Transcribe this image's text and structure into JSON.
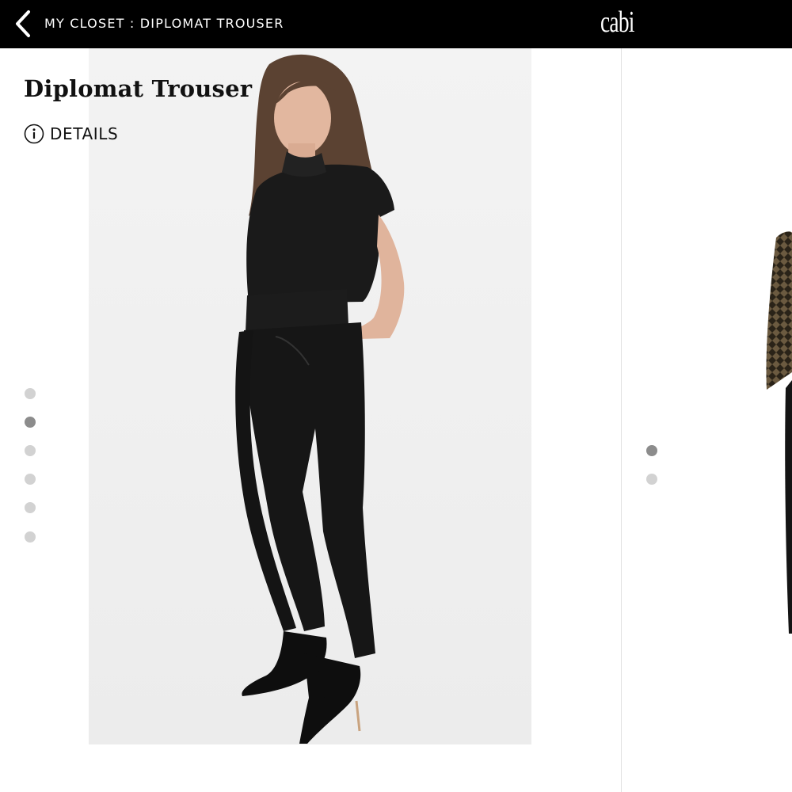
{
  "header": {
    "breadcrumb": "MY CLOSET : DIPLOMAT TROUSER",
    "logo_text": "cabi"
  },
  "product": {
    "title": "Diplomat Trouser",
    "details_label": "DETAILS",
    "image_alt": "Model wearing black Diplomat Trouser with black short-sleeve top and black heels"
  },
  "carousel": {
    "dot_count": 6,
    "active_index": 1
  },
  "next_item": {
    "dot_count": 2,
    "active_index": 0
  },
  "colors": {
    "header_bg": "#000000",
    "dot_inactive": "#d2d2d2",
    "dot_active": "#8c8c8c"
  },
  "icons": [
    "chevron-left-icon",
    "info-icon"
  ]
}
